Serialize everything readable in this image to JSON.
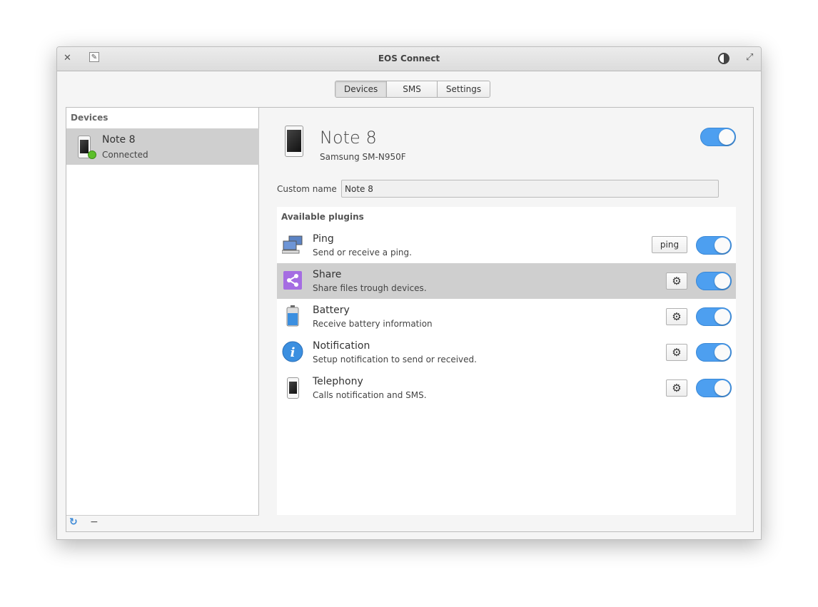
{
  "window": {
    "title": "EOS Connect"
  },
  "tabs": [
    {
      "label": "Devices",
      "active": true
    },
    {
      "label": "SMS"
    },
    {
      "label": "Settings"
    }
  ],
  "sidebar": {
    "header": "Devices",
    "devices": [
      {
        "name": "Note 8",
        "status": "Connected"
      }
    ],
    "icons": [
      "refresh-icon",
      "remove-icon"
    ]
  },
  "device": {
    "name": "Note 8",
    "model": "Samsung SM-N950F",
    "enabled": true,
    "custom_name_label": "Custom name",
    "custom_name_value": "Note 8"
  },
  "plugins": {
    "header": "Available plugins",
    "items": [
      {
        "title": "Ping",
        "desc": "Send or receive a ping.",
        "action": "ping",
        "enabled": true
      },
      {
        "title": "Share",
        "desc": "Share files trough devices.",
        "action": "settings",
        "enabled": true,
        "selected": true
      },
      {
        "title": "Battery",
        "desc": "Receive battery information",
        "action": "settings",
        "enabled": true
      },
      {
        "title": "Notification",
        "desc": "Setup notification to send or received.",
        "action": "settings",
        "enabled": true
      },
      {
        "title": "Telephony",
        "desc": "Calls notification and SMS.",
        "action": "settings",
        "enabled": true
      }
    ]
  },
  "colors": {
    "accent": "#4d9ff0",
    "selection": "#cfcfcf",
    "connected": "#5cbf2a",
    "share": "#a56de2"
  }
}
